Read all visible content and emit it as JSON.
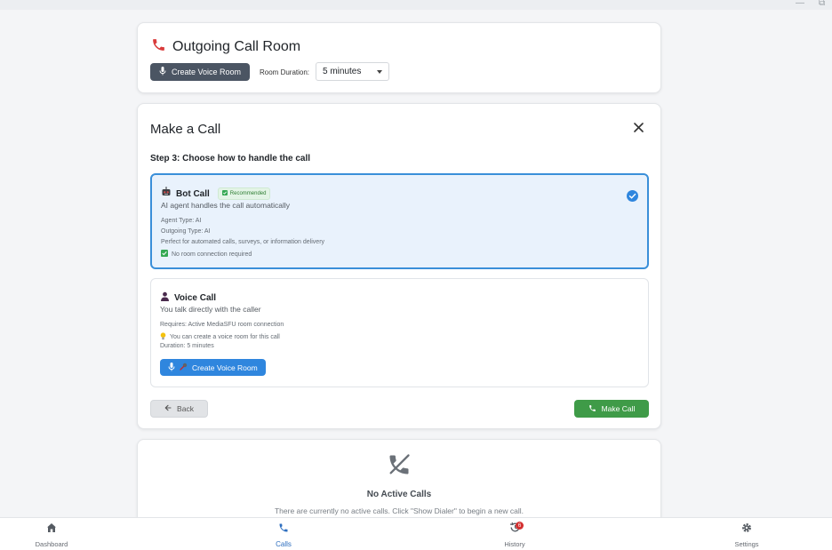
{
  "window": {
    "minimize_glyph": "—",
    "restore_glyph": "⧉"
  },
  "header": {
    "title": "Outgoing Call Room",
    "title_icon": "phone-outgoing-icon",
    "create_room_label": "Create Voice Room",
    "duration_label": "Room Duration:",
    "duration_value": "5 minutes"
  },
  "make_call": {
    "title": "Make a Call",
    "step_text": "Step 3: Choose how to handle the call",
    "bot_option": {
      "name": "Bot Call",
      "badge": "Recommended",
      "description": "AI agent handles the call automatically",
      "agent_type": "Agent Type: AI",
      "outgoing_type": "Outgoing Type: AI",
      "use_case": "Perfect for automated calls, surveys, or information delivery",
      "room_note": "No room connection required",
      "selected": true
    },
    "voice_option": {
      "name": "Voice Call",
      "description": "You talk directly with the caller",
      "requires": "Requires: Active MediaSFU room connection",
      "hint": "You can create a voice room for this call",
      "duration": "Duration: 5 minutes",
      "create_room_label": "Create Voice Room"
    },
    "back_label": "Back",
    "make_call_label": "Make Call"
  },
  "active_calls": {
    "title": "No Active Calls",
    "subtitle": "There are currently no active calls. Click \"Show Dialer\" to begin a new call."
  },
  "bottom_nav": {
    "items": [
      {
        "label": "Dashboard",
        "icon": "home-icon"
      },
      {
        "label": "Calls",
        "icon": "phone-icon",
        "active": true
      },
      {
        "label": "History",
        "icon": "history-icon",
        "badge": "6"
      },
      {
        "label": "Settings",
        "icon": "gear-icon"
      }
    ]
  },
  "colors": {
    "accent_blue": "#2f86de",
    "selected_border": "#3a8fd9",
    "success_green": "#3f9b48",
    "dark_button": "#4b5563",
    "phone_red": "#d93b3b"
  }
}
